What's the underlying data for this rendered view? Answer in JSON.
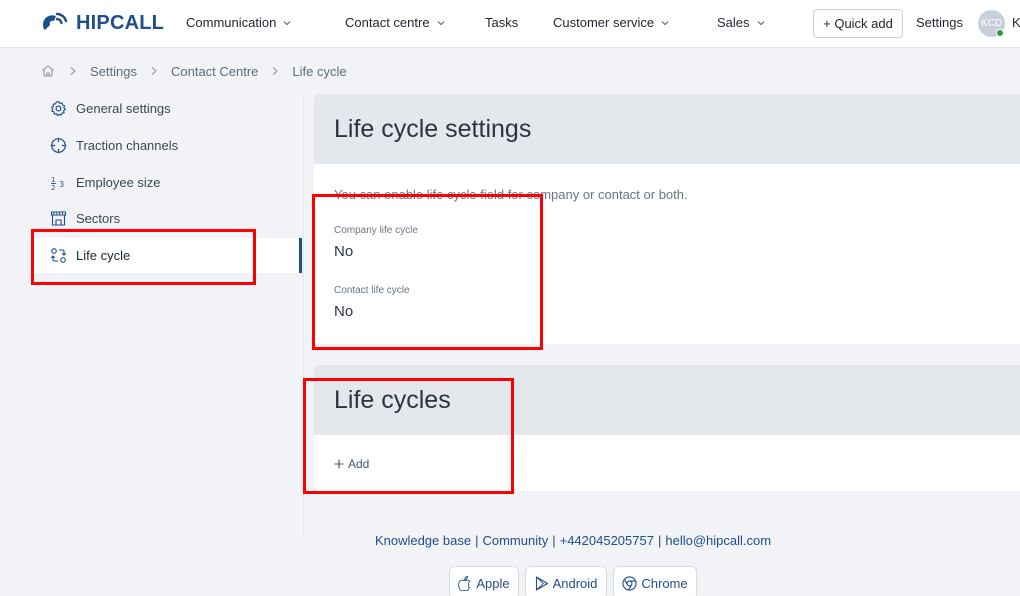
{
  "brand": {
    "logo_text": "HIPCALL"
  },
  "nav": {
    "communication": "Communication",
    "contact_centre": "Contact centre",
    "tasks": "Tasks",
    "customer_service": "Customer service",
    "sales": "Sales",
    "quick_add": "+ Quick add",
    "settings": "Settings",
    "avatar_initials": "KCD",
    "user_initial": "K"
  },
  "breadcrumb": {
    "items": [
      "Settings",
      "Contact Centre",
      "Life cycle"
    ]
  },
  "sidebar": {
    "items": [
      {
        "label": "General settings",
        "icon": "gear-icon"
      },
      {
        "label": "Traction channels",
        "icon": "crosshair-icon"
      },
      {
        "label": "Employee size",
        "icon": "fraction-icon"
      },
      {
        "label": "Sectors",
        "icon": "store-icon"
      },
      {
        "label": "Life cycle",
        "icon": "cycle-icon",
        "active": true
      }
    ]
  },
  "settings_card": {
    "title": "Life cycle settings",
    "description": "You can enable life cycle field for company or contact or both.",
    "company_label": "Company life cycle",
    "company_value": "No",
    "contact_label": "Contact life cycle",
    "contact_value": "No"
  },
  "cycles_card": {
    "title": "Life cycles",
    "add_label": "Add"
  },
  "footer": {
    "knowledge_base": "Knowledge base",
    "community": "Community",
    "phone": "+442045205757",
    "email": "hello@hipcall.com",
    "separator": "|",
    "apps": {
      "apple": "Apple",
      "android": "Android",
      "chrome": "Chrome"
    }
  },
  "colors": {
    "brand": "#1f4e8c",
    "highlight": "#ff0000",
    "status_online": "#2e9b3d"
  }
}
